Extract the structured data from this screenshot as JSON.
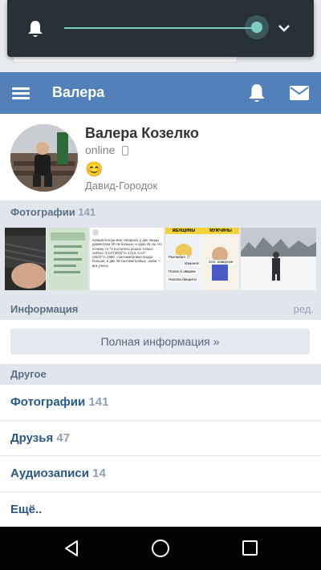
{
  "app": {
    "header_title": "Валера"
  },
  "profile": {
    "name": "Валера Козелко",
    "status": "online",
    "emoji": "😊",
    "city": "Давид-Городок"
  },
  "photos_section": {
    "label": "Фотографии",
    "count": "141",
    "thumbs": [
      {
        "text": ""
      },
      {
        "text": ""
      },
      {
        "text": "пуиция всегда мне говорила, у две пиццы диаметром 30 см больше, и одна 45 см. Но почему-то ^2 посчитать решил только сейчас: 3.14*(30/2)^2=1413, 3.14*(45/2)^2=1590. -сантиметровая пицца больше, и две 30-сантиметровых. ,живи — век учись!"
      },
      {
        "labels": [
          "ЖЕНЩИНЫ",
          "МУЖЧИНЫ",
          "Разлюбил",
          "Изменял",
          "Попал в аварию",
          "Напали бандиты",
          "Сел, наверное"
        ]
      },
      {
        "text": ""
      }
    ]
  },
  "info_section": {
    "label": "Информация",
    "edit_label": "ред.",
    "full_info_button": "Полная информация »"
  },
  "other_section": {
    "label": "Другое",
    "items": [
      {
        "label": "Фотографии",
        "count": "141"
      },
      {
        "label": "Друзья",
        "count": "47"
      },
      {
        "label": "Аудиозаписи",
        "count": "14"
      },
      {
        "label": "Ещё..",
        "count": ""
      }
    ]
  },
  "volume": {
    "level": 0.96,
    "accent_color": "#80cbc4",
    "panel_color": "#263238"
  },
  "colors": {
    "header": "#5181b8",
    "link": "#2a5885",
    "section_bg": "#e1e6ec"
  },
  "icons": [
    "bell-icon",
    "chevron-down-icon",
    "menu-icon",
    "notifications-icon",
    "mail-icon",
    "phone-icon",
    "back-icon",
    "home-icon",
    "recents-icon"
  ]
}
